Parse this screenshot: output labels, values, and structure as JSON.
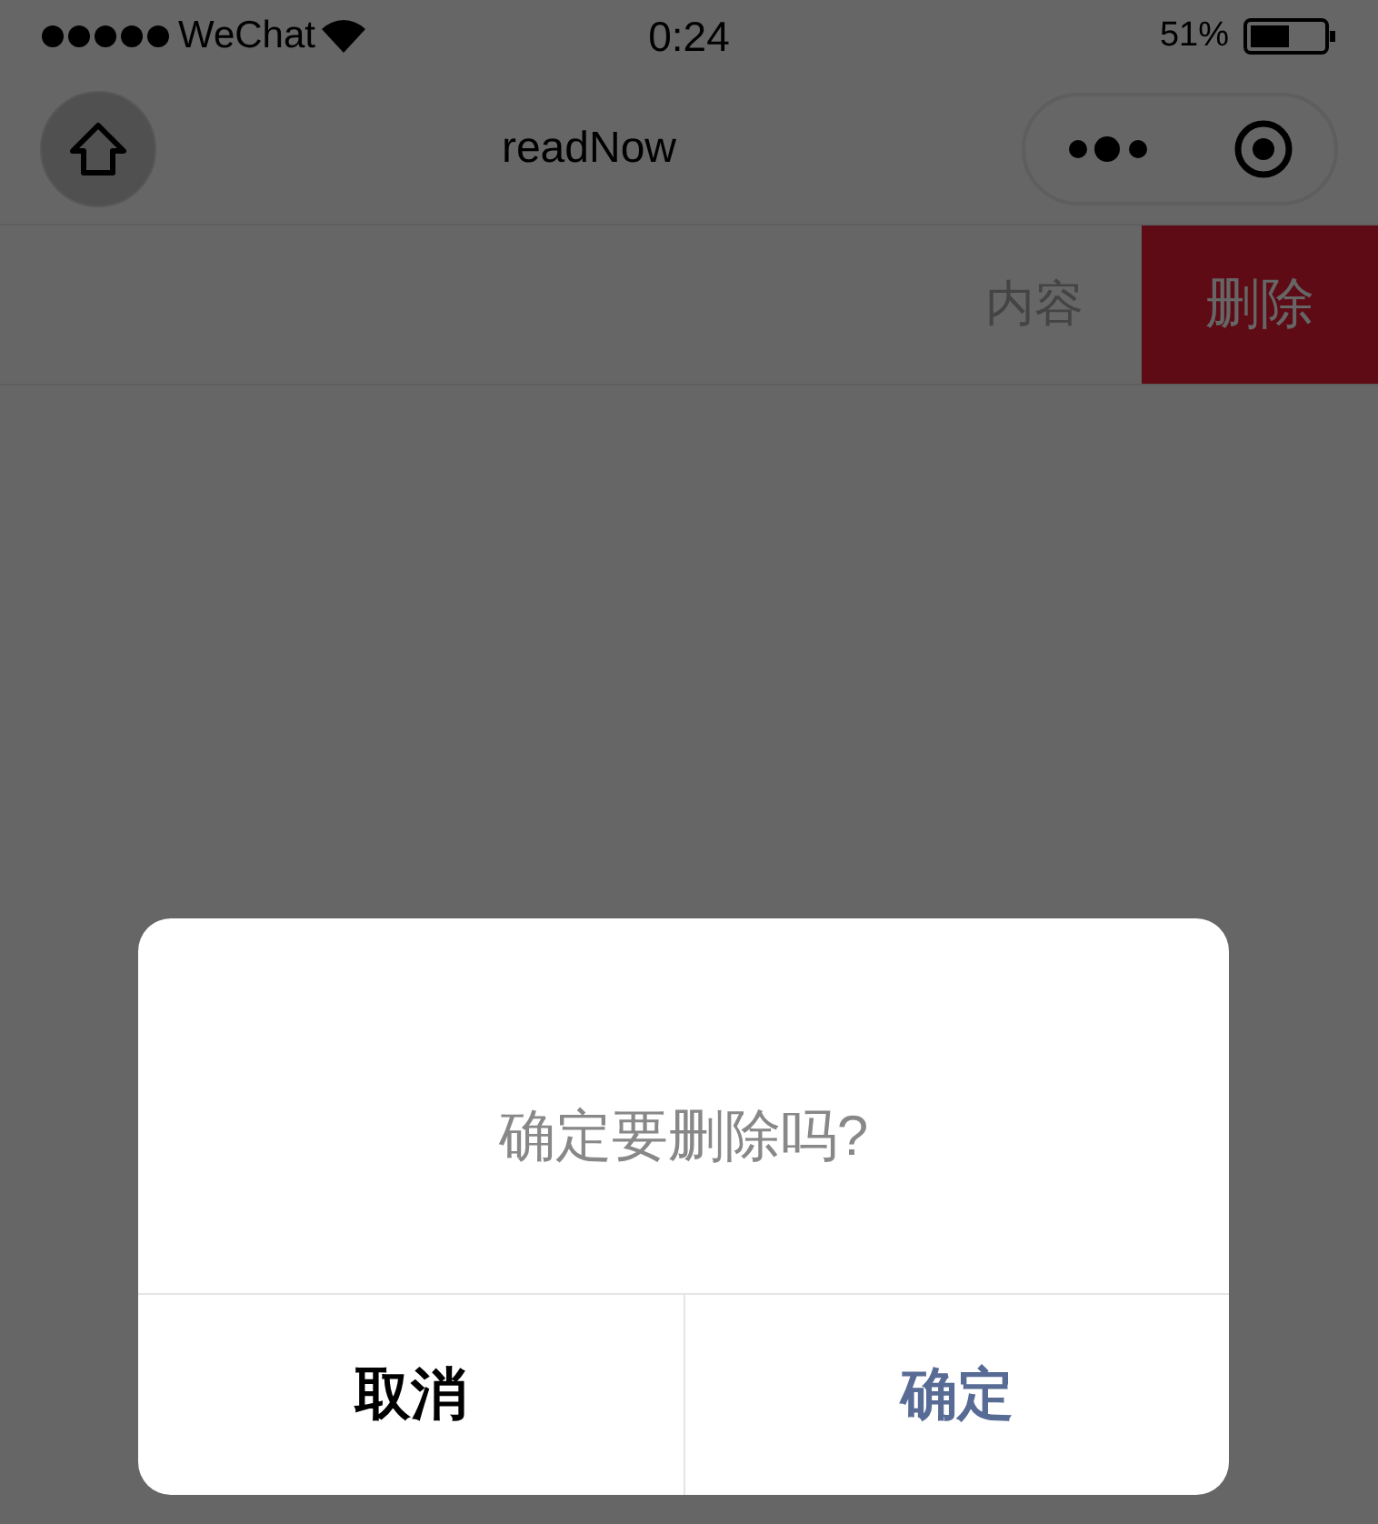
{
  "status_bar": {
    "carrier": "WeChat",
    "time": "0:24",
    "battery": "51%"
  },
  "nav_bar": {
    "title": "readNow"
  },
  "list_item": {
    "content": "内容",
    "delete_label": "删除"
  },
  "dialog": {
    "message": "确定要删除吗?",
    "buttons": [
      {
        "label": "取消",
        "kind": "cancel"
      },
      {
        "label": "确定",
        "kind": "confirm"
      }
    ]
  }
}
